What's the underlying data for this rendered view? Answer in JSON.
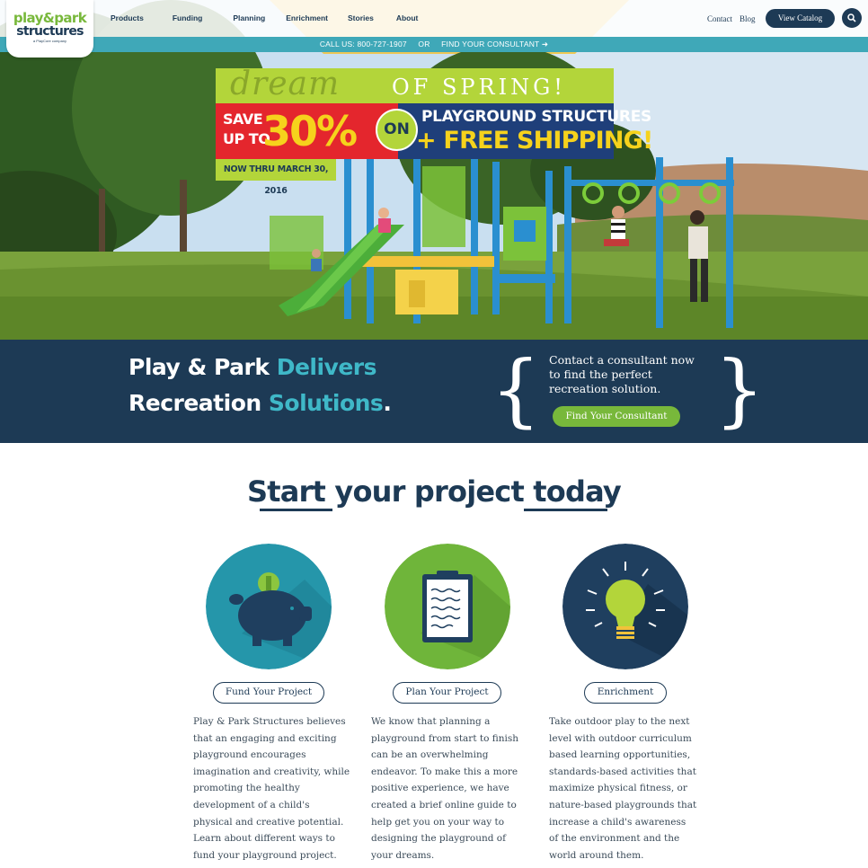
{
  "logo": {
    "line1": "play&park",
    "line2": "structures",
    "line3": "a PlayCore company"
  },
  "nav": {
    "items": [
      "Products",
      "Funding",
      "Planning",
      "Enrichment",
      "Stories",
      "About"
    ],
    "contact": "Contact",
    "blog": "Blog",
    "catalog": "View Catalog",
    "search_icon": "search-icon"
  },
  "callbar": {
    "call": "CALL US: 800-727-1907",
    "or": "OR",
    "find": "FIND YOUR CONSULTANT ➜"
  },
  "promo": {
    "dream": "dream",
    "of_spring": "OF SPRING!",
    "save": "SAVE\nUP TO",
    "percent": "30%",
    "on": "ON",
    "structures": "PLAYGROUND STRUCTURES",
    "shipping": "+ FREE SHIPPING!",
    "date": "NOW THRU MARCH 30, 2016"
  },
  "band": {
    "line1_a": "Play & Park ",
    "line1_b": "Delivers",
    "line2_a": "Recreation ",
    "line2_b": "Solutions",
    "line2_c": ".",
    "contact": "Contact a consultant now to find the perfect recreation solution.",
    "button": "Find Your Consultant"
  },
  "start": {
    "word1": "Start",
    "middle": " your project ",
    "word2": "today"
  },
  "columns": [
    {
      "button": "Fund Your Project",
      "icon": "piggy-bank-icon",
      "text": "Play & Park Structures believes that an engaging and exciting playground encourages imagination and creativity, while promoting the healthy development of a child's physical and creative potential. Learn about different ways to fund your playground project."
    },
    {
      "button": "Plan Your Project",
      "icon": "clipboard-icon",
      "text": "We know that planning a playground from start to finish can be an overwhelming endeavor. To make this a more positive experience, we have created a brief online guide to help get you on your way to designing the playground of your dreams."
    },
    {
      "button": "Enrichment",
      "icon": "lightbulb-icon",
      "text": "Take outdoor play to the next level with outdoor curriculum based learning opportunities, standards-based activities that maximize physical fitness, or nature-based playgrounds that increase a child's awareness of the environment and the world around them."
    }
  ],
  "colors": {
    "navy": "#1d3a55",
    "teal": "#3fa8b8",
    "green": "#78b83b",
    "lime": "#b3d53a",
    "red": "#e4262d",
    "yellow": "#f6d21c"
  }
}
